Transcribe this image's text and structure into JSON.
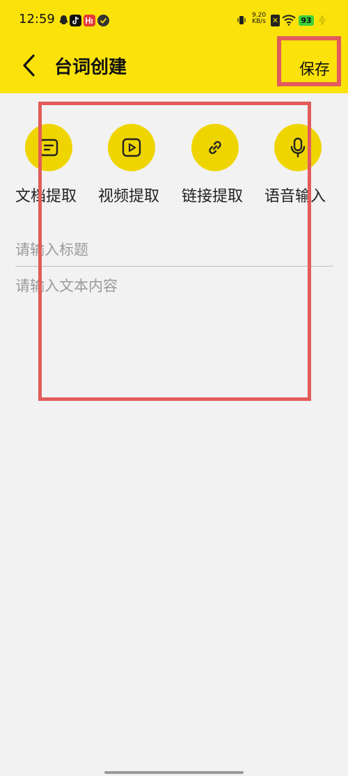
{
  "status_bar": {
    "time": "12:59",
    "net_speed_value": "9.20",
    "net_speed_unit": "KB/s",
    "battery": "93"
  },
  "header": {
    "title": "台词创建",
    "save_label": "保存"
  },
  "tools": [
    {
      "label": "文档提取",
      "icon": "document-icon"
    },
    {
      "label": "视频提取",
      "icon": "play-icon"
    },
    {
      "label": "链接提取",
      "icon": "link-icon"
    },
    {
      "label": "语音输入",
      "icon": "microphone-icon"
    }
  ],
  "form": {
    "title_placeholder": "请输入标题",
    "content_placeholder": "请输入文本内容"
  },
  "colors": {
    "header_bg": "#fbe20b",
    "tool_circle": "#efd500",
    "highlight": "#e35b5b"
  }
}
